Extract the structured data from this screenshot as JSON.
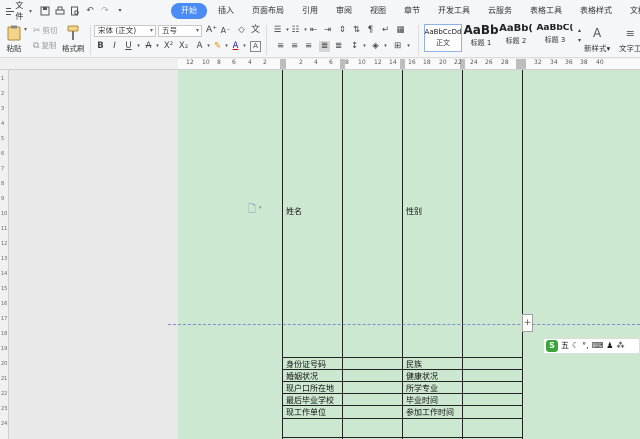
{
  "menubar": {
    "file_label": "文件",
    "tabs": [
      {
        "label": "开始",
        "active": true
      },
      {
        "label": "插入"
      },
      {
        "label": "页面布局"
      },
      {
        "label": "引用"
      },
      {
        "label": "审阅"
      },
      {
        "label": "视图"
      },
      {
        "label": "章节"
      },
      {
        "label": "开发工具"
      },
      {
        "label": "云服务"
      },
      {
        "label": "表格工具"
      },
      {
        "label": "表格样式"
      },
      {
        "label": "文档助手"
      }
    ],
    "accent_color": "#4b8bf4"
  },
  "ribbon": {
    "paste_label": "粘贴",
    "cut_label": "剪切",
    "copy_label": "复制",
    "format_painter_label": "格式刷",
    "font_name": "宋体 (正文)",
    "font_size": "五号",
    "styles": [
      {
        "sample": "AaBbCcDd",
        "name": "正文"
      },
      {
        "sample": "AaBb",
        "name": "标题 1"
      },
      {
        "sample": "AaBb(",
        "name": "标题 2"
      },
      {
        "sample": "AaBbC(",
        "name": "标题 3"
      }
    ],
    "new_style_label": "新样式",
    "text_tools_label": "文字工"
  },
  "ruler": {
    "numbers": [
      "12",
      "10",
      "8",
      "6",
      "4",
      "2",
      "2",
      "4",
      "6",
      "8",
      "10",
      "12",
      "14",
      "16",
      "18",
      "20",
      "22",
      "24",
      "26",
      "28",
      "32",
      "34",
      "36",
      "38",
      "40"
    ]
  },
  "document": {
    "page_color": "#cde8d0",
    "cells": {
      "name": "姓名",
      "gender": "性别",
      "id_number": "身份证号码",
      "ethnicity": "民族",
      "marital": "婚姻状况",
      "health": "健康状况",
      "hukou": "现户口所在地",
      "major": "所学专业",
      "school": "最后毕业学校",
      "graduation": "毕业时间",
      "employer": "现工作单位",
      "work_start": "参加工作时间"
    }
  },
  "ime": {
    "logo": "S",
    "mode": "五"
  }
}
